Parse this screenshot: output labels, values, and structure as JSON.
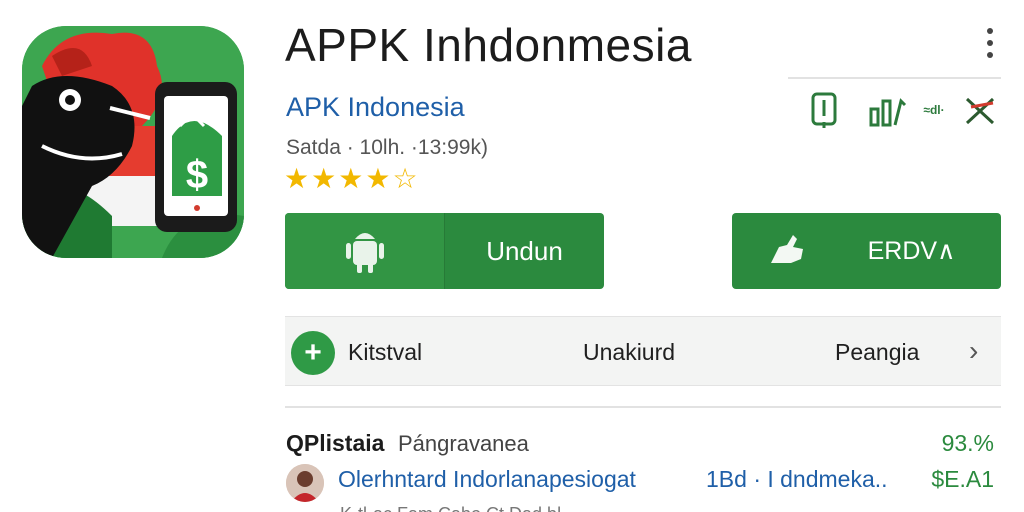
{
  "app": {
    "title": "APPK Inhdonmesia",
    "developer": "APK Indonesia",
    "meta": "Satda · 10lh. ·13:99k)",
    "rating_stars": 4,
    "rating_max": 5
  },
  "action_icons": {
    "label_small": "≈dl·"
  },
  "buttons": {
    "download_label": "Undun",
    "secondary_label": "ERDV∧"
  },
  "info_bar": {
    "label1": "Kitstval",
    "label2": "Unakiurd",
    "label3": "Peangia"
  },
  "list": {
    "row_a_title": "QPlistaia",
    "row_a_subtitle": "Pángravanea",
    "row_a_value": "93.%",
    "row_b_link1": "Olerhntard Indorlanapesiogat",
    "row_b_link2": "1Bd · I dndmeka..",
    "row_b_value": "$E.A1",
    "row_c_text": "K·tl·ac   Fam   Cabo  Ct  Dad.bl"
  },
  "colors": {
    "accent_green": "#2b8a3e",
    "link_blue": "#1f5fa8",
    "star_gold": "#f2b800"
  }
}
